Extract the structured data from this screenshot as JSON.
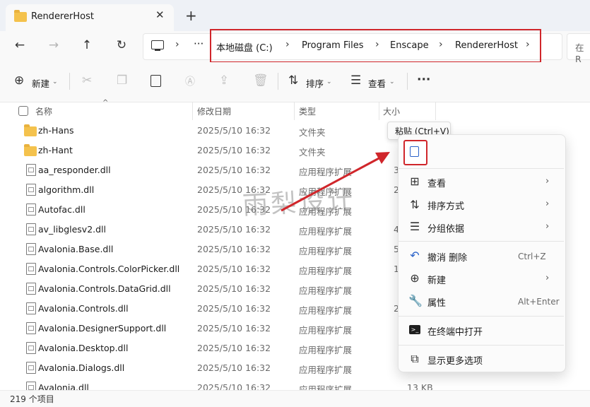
{
  "tab": {
    "title": "RendererHost"
  },
  "breadcrumbs": [
    "本地磁盘 (C:)",
    "Program Files",
    "Enscape",
    "RendererHost"
  ],
  "search_fragment": "在 R",
  "toolbar": {
    "new_label": "新建",
    "sort_label": "排序",
    "view_label": "查看"
  },
  "columns": {
    "name": "名称",
    "date": "修改日期",
    "type": "类型",
    "size": "大小"
  },
  "files": [
    {
      "name": "zh-Hans",
      "date": "2025/5/10 16:32",
      "type": "文件夹",
      "size": "",
      "kind": "folder"
    },
    {
      "name": "zh-Hant",
      "date": "2025/5/10 16:32",
      "type": "文件夹",
      "size": "",
      "kind": "folder"
    },
    {
      "name": "aa_responder.dll",
      "date": "2025/5/10 16:32",
      "type": "应用程序扩展",
      "size": "3",
      "kind": "file"
    },
    {
      "name": "algorithm.dll",
      "date": "2025/5/10 16:32",
      "type": "应用程序扩展",
      "size": "21",
      "kind": "file"
    },
    {
      "name": "Autofac.dll",
      "date": "2025/5/10 16:32",
      "type": "应用程序扩展",
      "size": "",
      "kind": "file"
    },
    {
      "name": "av_libglesv2.dll",
      "date": "2025/5/10 16:32",
      "type": "应用程序扩展",
      "size": "4",
      "kind": "file"
    },
    {
      "name": "Avalonia.Base.dll",
      "date": "2025/5/10 16:32",
      "type": "应用程序扩展",
      "size": "5",
      "kind": "file"
    },
    {
      "name": "Avalonia.Controls.ColorPicker.dll",
      "date": "2025/5/10 16:32",
      "type": "应用程序扩展",
      "size": "1",
      "kind": "file"
    },
    {
      "name": "Avalonia.Controls.DataGrid.dll",
      "date": "2025/5/10 16:32",
      "type": "应用程序扩展",
      "size": "",
      "kind": "file"
    },
    {
      "name": "Avalonia.Controls.dll",
      "date": "2025/5/10 16:32",
      "type": "应用程序扩展",
      "size": "2",
      "kind": "file"
    },
    {
      "name": "Avalonia.DesignerSupport.dll",
      "date": "2025/5/10 16:32",
      "type": "应用程序扩展",
      "size": "",
      "kind": "file"
    },
    {
      "name": "Avalonia.Desktop.dll",
      "date": "2025/5/10 16:32",
      "type": "应用程序扩展",
      "size": "",
      "kind": "file"
    },
    {
      "name": "Avalonia.Dialogs.dll",
      "date": "2025/5/10 16:32",
      "type": "应用程序扩展",
      "size": "",
      "kind": "file"
    },
    {
      "name": "Avalonia.dll",
      "date": "2025/5/10 16:32",
      "type": "应用程序扩展",
      "size": "13 KB",
      "kind": "file"
    }
  ],
  "status": {
    "count": "219 个项目"
  },
  "watermark": "雨梨设计",
  "tooltip": "粘贴 (Ctrl+V)",
  "context_menu": {
    "view": "查看",
    "sort": "排序方式",
    "group": "分组依据",
    "undo": "撤消 删除",
    "undo_shortcut": "Ctrl+Z",
    "new": "新建",
    "properties": "属性",
    "properties_shortcut": "Alt+Enter",
    "terminal": "在终端中打开",
    "more": "显示更多选项"
  },
  "colors": {
    "highlight_red": "#d0262b",
    "folder_yellow": "#f4c24d"
  }
}
